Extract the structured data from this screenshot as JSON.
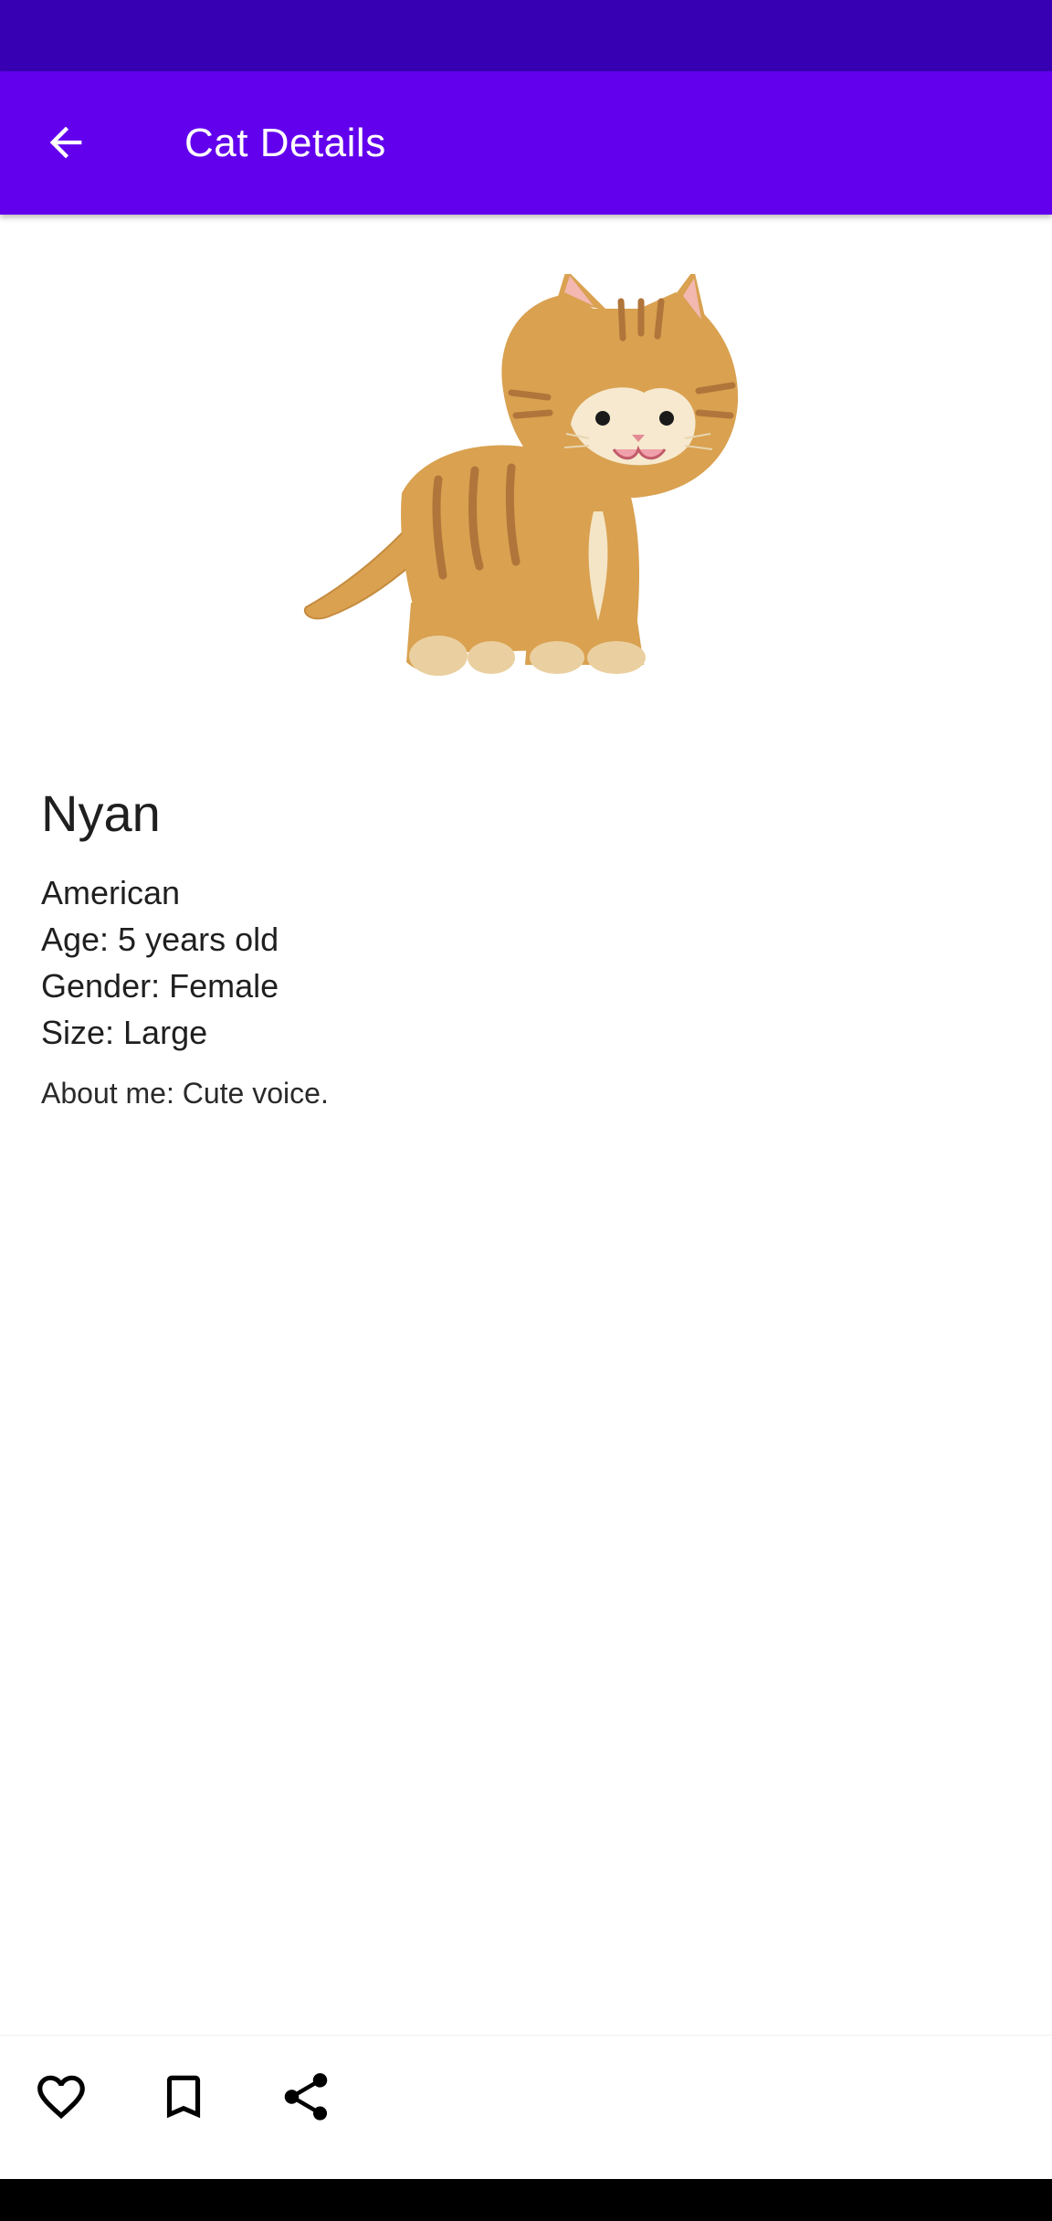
{
  "colors": {
    "status_bar": "#3700b3",
    "app_bar": "#6200ee",
    "on_primary": "#ffffff"
  },
  "app_bar": {
    "title": "Cat Details",
    "back_icon": "arrow-back-icon"
  },
  "cat": {
    "image": "tabby-cat-illustration",
    "name": "Nyan",
    "breed": "American",
    "age": "Age: 5 years old",
    "gender": "Gender: Female",
    "size": "Size: Large",
    "about": "About me: Cute voice."
  },
  "actions": [
    {
      "name": "like",
      "icon": "heart-outline-icon"
    },
    {
      "name": "bookmark",
      "icon": "bookmark-outline-icon"
    },
    {
      "name": "share",
      "icon": "share-icon"
    }
  ]
}
